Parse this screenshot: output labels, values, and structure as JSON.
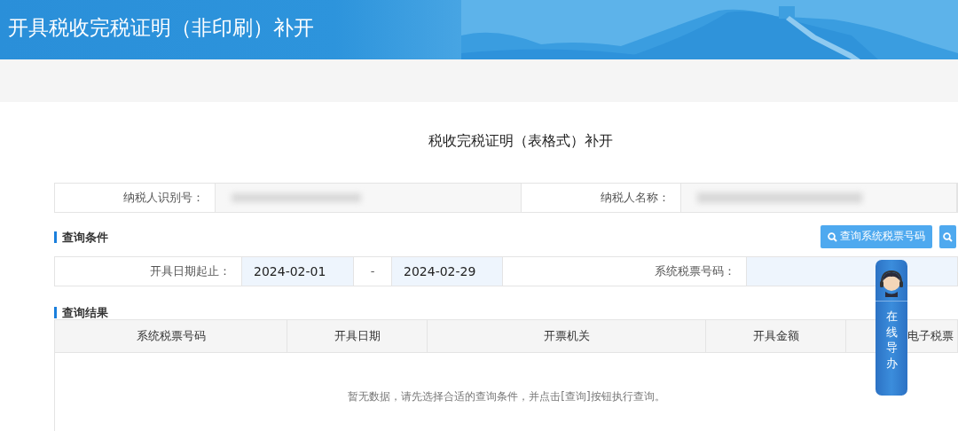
{
  "header": {
    "title": "开具税收完税证明（非印刷）补开"
  },
  "form_title": "税收完税证明（表格式）补开",
  "taxpayer_info": [
    {
      "label": "纳税人识别号："
    },
    {
      "label": "纳税人名称："
    }
  ],
  "query_section": {
    "title": "查询条件",
    "buttons": [
      {
        "label": "查询系统税票号码",
        "kind": "labeled"
      },
      {
        "kind": "icon"
      }
    ],
    "date_label": "开具日期起止：",
    "date_from": "2024-02-01",
    "separator": "-",
    "date_to": "2024-02-29",
    "ticket_label": "系统税票号码："
  },
  "results": {
    "title": "查询结果",
    "columns": [
      "系统税票号码",
      "开具日期",
      "开票机关",
      "开具金额",
      "电子税票"
    ],
    "empty_message": "暂无数据，请先选择合适的查询条件，并点击[查询]按钮执行查询。"
  },
  "guide_widget": {
    "label": "在线导办"
  }
}
